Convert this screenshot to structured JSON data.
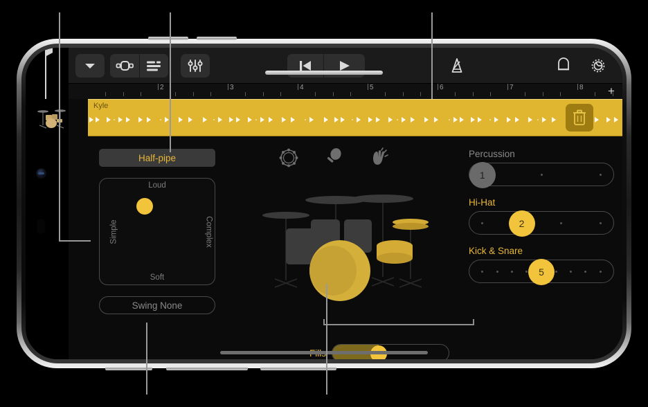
{
  "annotation": {
    "callout_color": "#9a9a9a",
    "top_lines_x": [
      85,
      246,
      624
    ],
    "bottom_lines_x": [
      212,
      472
    ]
  },
  "toolbar": {
    "buttons": [
      {
        "name": "chevron-down-icon",
        "label": "Close / My Songs"
      },
      {
        "name": "navigation-icon",
        "label": "Navigation"
      },
      {
        "name": "tracks-icon",
        "label": "Track View"
      },
      {
        "name": "mixer-icon",
        "label": "Mixer / FX"
      },
      {
        "name": "rewind-icon",
        "label": "Go to Beginning"
      },
      {
        "name": "play-icon",
        "label": "Play"
      },
      {
        "name": "metronome-icon",
        "label": "Metronome"
      },
      {
        "name": "cycle-icon",
        "label": "Cycle / Loop"
      },
      {
        "name": "gear-icon",
        "label": "Settings"
      }
    ]
  },
  "ruler": {
    "bars": [
      "2",
      "3",
      "4",
      "5",
      "6",
      "7",
      "8"
    ],
    "add_label": "+",
    "playhead_bar": 1
  },
  "track": {
    "region_name": "Kyle",
    "instrument_icon": "drum-kit-icon",
    "delete_label": "Delete",
    "region_color": "#e0b52f"
  },
  "left_panel": {
    "preset_name": "Half-pipe",
    "xy_pad": {
      "top_label": "Loud",
      "bottom_label": "Soft",
      "left_label": "Simple",
      "right_label": "Complex",
      "knob_x_pct": 32,
      "knob_y_pct": 18
    },
    "swing_label": "Swing None"
  },
  "center_panel": {
    "percussion_icons": [
      {
        "name": "tambourine-icon",
        "label": "Tambourine"
      },
      {
        "name": "shaker-icon",
        "label": "Shaker"
      },
      {
        "name": "clap-icon",
        "label": "Hand Clap"
      }
    ],
    "kit_name": "drum-kit",
    "fills_label": "Fills",
    "fills_value_pct": 40
  },
  "right_panel": {
    "sliders": [
      {
        "label": "Percussion",
        "value": "1",
        "active": false,
        "steps": 3,
        "index": 0
      },
      {
        "label": "Hi-Hat",
        "value": "2",
        "active": true,
        "steps": 4,
        "index": 1
      },
      {
        "label": "Kick & Snare",
        "value": "5",
        "active": true,
        "steps": 9,
        "index": 4
      }
    ]
  },
  "colors": {
    "accent_yellow": "#f2c43c",
    "region_yellow": "#e0b52f",
    "inactive_gray": "#6a6a6a",
    "background": "#0b0b0b"
  }
}
